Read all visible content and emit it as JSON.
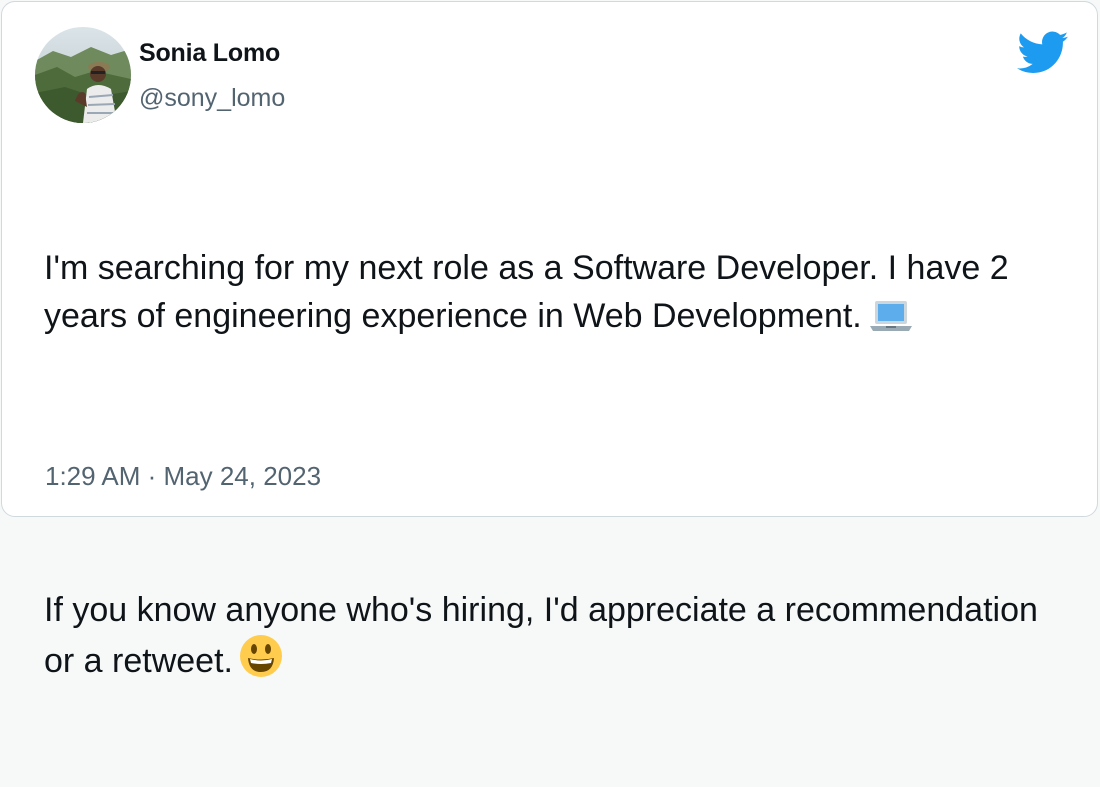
{
  "author": {
    "name": "Sonia Lomo",
    "handle": "@sony_lomo"
  },
  "tweet": {
    "paragraph_1": "I'm searching for my next role as a Software Developer. I have 2 years of engineering experience in Web Development.",
    "paragraph_2": "If you know anyone who's hiring, I'd appreciate a recommendation or a retweet.",
    "emoji_1": "laptop-emoji",
    "emoji_2": "grinning-face-emoji"
  },
  "meta": {
    "timestamp": "1:29 AM · May 24, 2023"
  },
  "icons": {
    "brand": "twitter-bird-icon"
  },
  "colors": {
    "brand": "#1d9bf0",
    "text_primary": "#0f1419",
    "text_secondary": "#536471",
    "border": "#cfd9de"
  }
}
